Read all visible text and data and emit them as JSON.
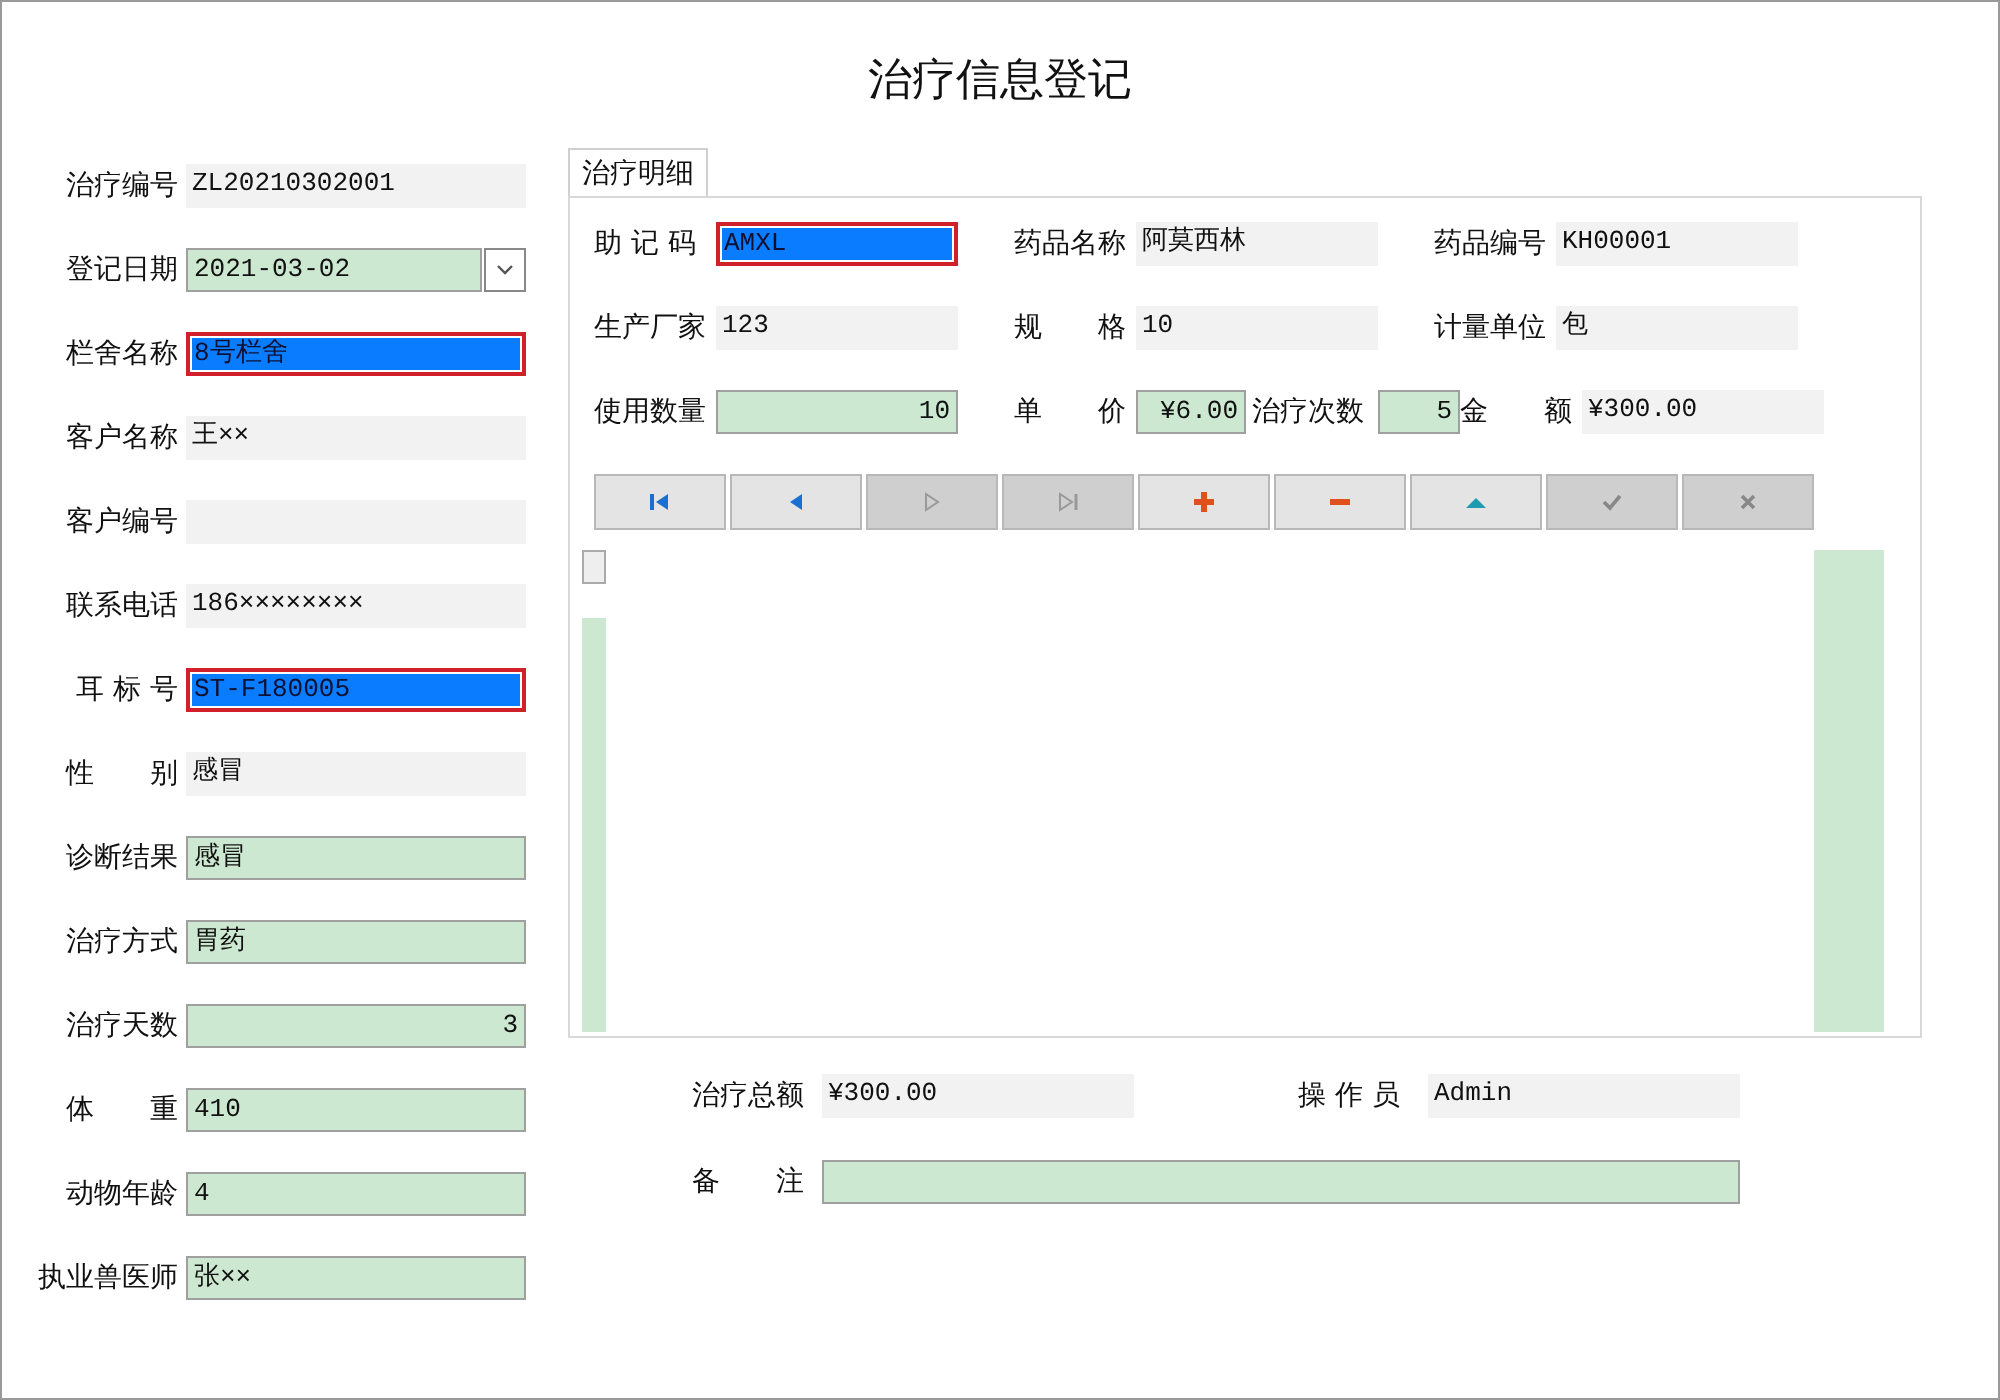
{
  "window": {
    "title": "治疗信息登记"
  },
  "left_fields": [
    {
      "label": "治疗编号",
      "value": "ZL20210302001",
      "kind": "readonly",
      "right_aligned": false
    },
    {
      "label": "登记日期",
      "value": "2021-03-02",
      "kind": "date",
      "right_aligned": false
    },
    {
      "label": "栏舍名称",
      "value": "8号栏舍",
      "kind": "selected",
      "right_aligned": false
    },
    {
      "label": "客户名称",
      "value": "王××",
      "kind": "readonly",
      "right_aligned": false
    },
    {
      "label": "客户编号",
      "kind": "readonly"
    },
    {
      "label": "联系电话",
      "value": "186××××××××",
      "kind": "readonly",
      "right_aligned": false
    },
    {
      "label": "耳 标 号",
      "value": "ST-F180005",
      "kind": "selected",
      "right_aligned": false
    },
    {
      "label": "性　　别",
      "value": "感冒",
      "kind": "readonly",
      "right_aligned": false
    },
    {
      "label": "诊断结果",
      "value": "感冒",
      "kind": "editable",
      "right_aligned": false
    },
    {
      "label": "治疗方式",
      "value": "胃药",
      "kind": "editable",
      "right_aligned": false
    },
    {
      "label": "治疗天数",
      "value": "3",
      "kind": "editable",
      "right_aligned": true
    },
    {
      "label": "体　　重",
      "value": "410",
      "kind": "editable",
      "right_aligned": false
    },
    {
      "label": "动物年龄",
      "value": "4",
      "kind": "editable",
      "right_aligned": false
    },
    {
      "label": "执业兽医师",
      "value": "张××",
      "kind": "editable",
      "right_aligned": false
    }
  ],
  "tabs": [
    {
      "label": "治疗明细",
      "selected": true
    }
  ],
  "detail_rows": [
    [
      {
        "label": "助 记 码",
        "value": "AMXL",
        "kind": "selected",
        "right_aligned": false
      },
      {
        "label": "药品名称",
        "value": "阿莫西林",
        "kind": "readonly",
        "right_aligned": false
      },
      {
        "label": "药品编号",
        "value": "KH00001",
        "kind": "readonly",
        "right_aligned": false
      }
    ],
    [
      {
        "label": "生产厂家",
        "value": "123",
        "kind": "readonly",
        "right_aligned": false
      },
      {
        "label": "规　　格",
        "value": "10",
        "kind": "readonly",
        "right_aligned": false
      },
      {
        "label": "计量单位",
        "value": "包",
        "kind": "readonly",
        "right_aligned": false
      }
    ],
    [
      {
        "label": "使用数量",
        "value": "10",
        "kind": "editable",
        "right_aligned": true
      },
      {
        "label": "单　　价",
        "value": "¥6.00",
        "kind": "editable",
        "right_aligned": true
      },
      {
        "label": "治疗次数",
        "value": "5",
        "kind": "editable",
        "right_aligned": true
      },
      {
        "label": "金　　额",
        "value": "¥300.00",
        "kind": "readonly",
        "right_aligned": false
      }
    ]
  ],
  "nav_buttons": [
    {
      "kind": "first",
      "disabled": false
    },
    {
      "kind": "prev",
      "disabled": false
    },
    {
      "kind": "next",
      "disabled": true
    },
    {
      "kind": "last",
      "disabled": true
    },
    {
      "kind": "add",
      "disabled": false
    },
    {
      "kind": "delete",
      "disabled": false
    },
    {
      "kind": "edit",
      "disabled": false
    },
    {
      "kind": "post",
      "disabled": true
    },
    {
      "kind": "cancel",
      "disabled": true
    }
  ],
  "summary_fields": [
    {
      "label": "治疗总额",
      "value": "¥300.00",
      "kind": "readonly",
      "right_aligned": false
    },
    {
      "label": "操 作 员",
      "value": "Admin",
      "kind": "readonly",
      "right_aligned": false
    },
    {
      "label": "备　　注",
      "kind": "editable"
    }
  ]
}
